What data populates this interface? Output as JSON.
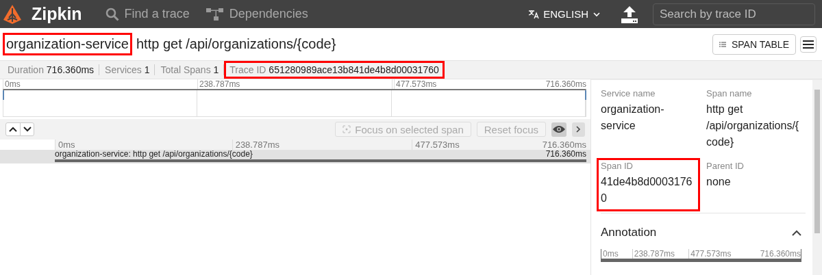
{
  "header": {
    "logo": "Zipkin",
    "nav": [
      {
        "label": "Find a trace"
      },
      {
        "label": "Dependencies"
      }
    ],
    "language": "ENGLISH",
    "search": {
      "placeholder": "Search by trace ID"
    }
  },
  "trace": {
    "service": "organization-service",
    "service_highlighted": true,
    "name": "http get /api/organizations/{code}",
    "span_table_button": "SPAN TABLE"
  },
  "stats": [
    {
      "label": "Duration",
      "value": "716.360ms",
      "highlighted": false
    },
    {
      "label": "Services",
      "value": "1",
      "highlighted": false
    },
    {
      "label": "Total Spans",
      "value": "1",
      "highlighted": false
    },
    {
      "label": "Trace ID",
      "value": "651280989ace13b841de4b8d00031760",
      "highlighted": true
    }
  ],
  "minimap": {
    "ticks": [
      "0ms",
      "238.787ms",
      "477.573ms",
      "716.360ms"
    ]
  },
  "controls": {
    "focus_button": {
      "label": "Focus on selected span",
      "disabled": true
    },
    "reset_button": {
      "label": "Reset focus",
      "disabled": true
    }
  },
  "timeline": {
    "ticks": [
      "0ms",
      "238.787ms",
      "477.573ms",
      "716.360ms"
    ],
    "spans": [
      {
        "label": "organization-service: http get /api/organizations/{code}",
        "duration": "716.360ms",
        "selected": true
      }
    ]
  },
  "detail": {
    "fields": [
      {
        "label": "Service name",
        "value": "organization-service",
        "highlighted": false
      },
      {
        "label": "Span name",
        "value": "http get /api/organizations/{code}",
        "highlighted": false
      },
      {
        "label": "Span ID",
        "value": "41de4b8d00031760",
        "highlighted": true
      },
      {
        "label": "Parent ID",
        "value": "none",
        "highlighted": false
      }
    ],
    "annotation": {
      "title": "Annotation",
      "expanded": true,
      "ticks": [
        "0ms",
        "238.787ms",
        "477.573ms",
        "716.360ms"
      ]
    }
  }
}
